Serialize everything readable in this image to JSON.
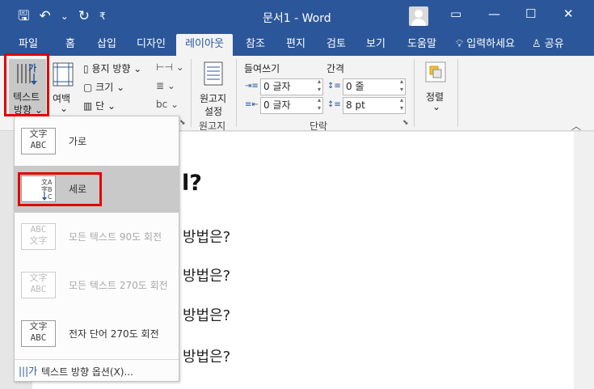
{
  "window": {
    "doc_title": "문서1  -  Word",
    "controls": [
      "▭",
      "—",
      "☐",
      "✕"
    ]
  },
  "qat": {
    "save": "🖫",
    "undo": "↶",
    "undo_arrow": "⌄",
    "redo": "↻",
    "customize": "₹"
  },
  "tabs": [
    {
      "label": "파일"
    },
    {
      "label": "홈"
    },
    {
      "label": "삽입"
    },
    {
      "label": "디자인"
    },
    {
      "label": "레이아웃",
      "active": true
    },
    {
      "label": "참조"
    },
    {
      "label": "편지"
    },
    {
      "label": "검토"
    },
    {
      "label": "보기"
    },
    {
      "label": "도움말"
    }
  ],
  "tell_me": "입력하세요",
  "share": "공유",
  "ribbon": {
    "text_direction": {
      "line1": "텍스트",
      "line2": "방향 ⌄"
    },
    "margins": {
      "line1": "여백",
      "line2": "⌄"
    },
    "orientation": "용지 방향 ⌄",
    "size": "크기 ⌄",
    "columns": "단 ⌄",
    "manuscript": {
      "line1": "원고지",
      "line2": "설정",
      "group": "원고지"
    },
    "indent": {
      "header": "들여쓰기",
      "left": "0 글자",
      "right": "0 글자"
    },
    "spacing": {
      "header": "간격",
      "before": "0 줄",
      "after": "8 pt"
    },
    "paragraph_group": "단락",
    "arrange": "정렬",
    "arrange_arrow": "⌄",
    "collapse": "︿"
  },
  "dropdown": {
    "items": [
      {
        "label": "가로",
        "icon_text": "文字\nABC",
        "enabled": true,
        "selected": false
      },
      {
        "label": "세로",
        "icon_text": "文 字 ABC",
        "enabled": true,
        "selected": true
      },
      {
        "label": "모든 텍스트 90도 회전",
        "icon_text": "文字\nABC",
        "enabled": false,
        "selected": false
      },
      {
        "label": "모든 텍스트 270도 회전",
        "icon_text": "文字\nABC",
        "enabled": false,
        "selected": false
      },
      {
        "label": "전자 단어 270도 회전",
        "icon_text": "文字\nABC",
        "enabled": true,
        "selected": false
      }
    ],
    "options_label": "텍스트 방향 옵션(X)..."
  },
  "document": {
    "heading": "l?",
    "lines": [
      "방법은?",
      "방법은?",
      "방법은?",
      "방법은?"
    ]
  }
}
